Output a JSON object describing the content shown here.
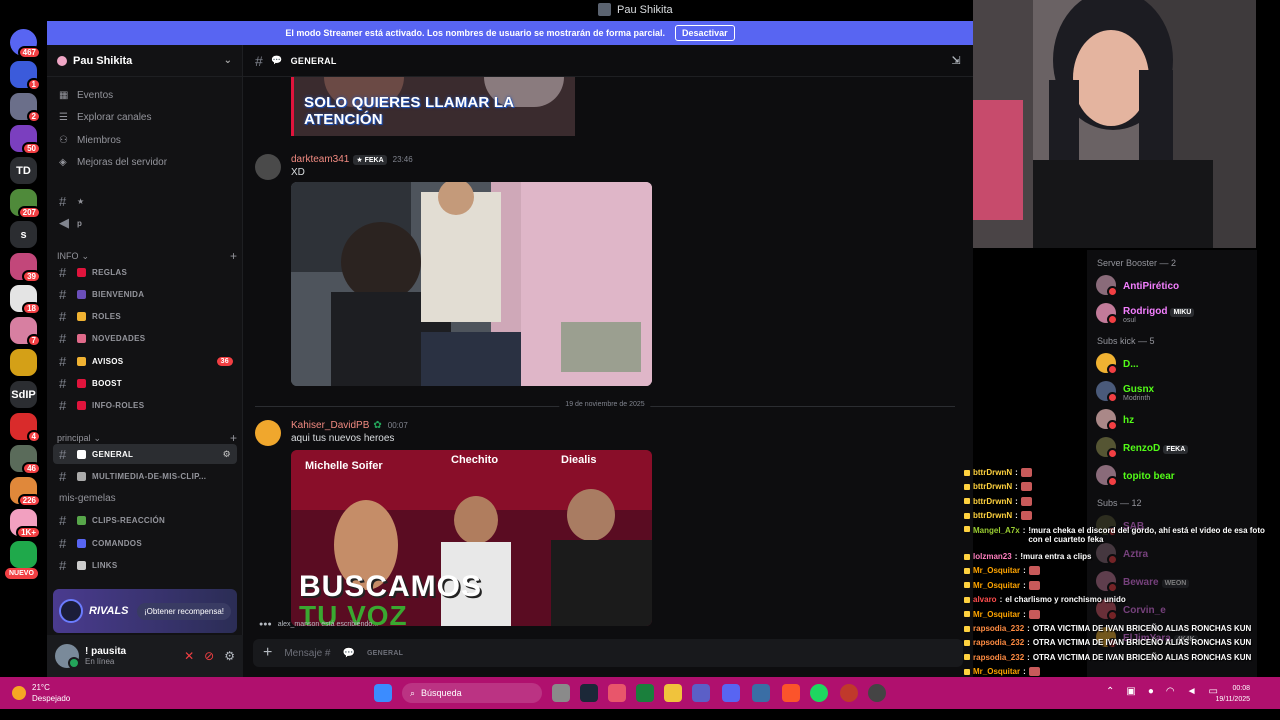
{
  "window": {
    "title": "Pau Shikita"
  },
  "server_rail": {
    "items": [
      {
        "name": "discord-home",
        "badge": "467",
        "color": "#5865f2",
        "label": ""
      },
      {
        "name": "server-1",
        "badge": "1",
        "color": "#3b5bdb",
        "label": ""
      },
      {
        "name": "server-2",
        "badge": "2",
        "color": "#6b6f8a",
        "label": ""
      },
      {
        "name": "server-3",
        "badge": "50",
        "color": "#7b3fbf",
        "label": ""
      },
      {
        "name": "server-td",
        "badge": "",
        "color": "#2b2d31",
        "label": "TD"
      },
      {
        "name": "server-5",
        "badge": "207",
        "color": "#4f8a3a",
        "label": ""
      },
      {
        "name": "server-s",
        "badge": "",
        "color": "#2b2d31",
        "label": "s"
      },
      {
        "name": "server-7",
        "badge": "39",
        "color": "#c2477a",
        "label": ""
      },
      {
        "name": "server-8",
        "badge": "18",
        "color": "#e4e4e4",
        "label": ""
      },
      {
        "name": "server-9",
        "badge": "7",
        "color": "#d77fa1",
        "label": ""
      },
      {
        "name": "server-10",
        "badge": "",
        "color": "#d4a017",
        "label": ""
      },
      {
        "name": "server-sdp",
        "badge": "",
        "color": "#2b2d31",
        "label": "SdIP"
      },
      {
        "name": "server-12",
        "badge": "4",
        "color": "#d92b2b",
        "label": ""
      },
      {
        "name": "server-13",
        "badge": "46",
        "color": "#5a6b5a",
        "label": ""
      },
      {
        "name": "server-14",
        "badge": "226",
        "color": "#e0883a",
        "label": ""
      },
      {
        "name": "server-15",
        "badge": "1K+",
        "color": "#f2a0c0",
        "label": ""
      },
      {
        "name": "server-16",
        "badge": "",
        "color": "#1fa94b",
        "label": ""
      }
    ],
    "new_label": "NUEVO"
  },
  "banner": {
    "text": "El modo Streamer está activado. Los nombres de usuario se mostrarán de forma parcial.",
    "button": "Desactivar"
  },
  "sidebar": {
    "guild_name": "Pau Shikita",
    "nav": [
      "Eventos",
      "Explorar canales",
      "Miembros",
      "Mejoras del servidor"
    ],
    "pinned": [
      "★",
      "p"
    ],
    "info_category": "INFO",
    "info_channels": [
      {
        "name": "REGLAS",
        "badge": "",
        "emoji_color": "#e0143c"
      },
      {
        "name": "BIENVENIDA",
        "badge": "",
        "emoji_color": "#6b4fbb"
      },
      {
        "name": "ROLES",
        "badge": "",
        "emoji_color": "#f0b232"
      },
      {
        "name": "NOVEDADES",
        "badge": "",
        "emoji_color": "#e06a8a"
      },
      {
        "name": "AVISOS",
        "badge": "36",
        "emoji_color": "#f0b232"
      },
      {
        "name": "BOOST",
        "badge": "",
        "emoji_color": "#e0143c"
      },
      {
        "name": "INFO-ROLES",
        "badge": "",
        "emoji_color": "#e0143c"
      }
    ],
    "principal_category": "principal",
    "principal_channels": [
      {
        "name": "GENERAL",
        "emoji_color": "#ffffff"
      },
      {
        "name": "MULTIMEDIA-DE-MIS-CLIP...",
        "emoji_color": "#aaaaaa"
      },
      {
        "name": "mis-gemelas",
        "emoji_color": ""
      },
      {
        "name": "CLIPS-REACCIÓN",
        "emoji_color": "#57a64a"
      },
      {
        "name": "COMANDOS",
        "emoji_color": "#5865f2"
      },
      {
        "name": "LINKS",
        "emoji_color": "#cccccc"
      }
    ],
    "promo": {
      "brand": "RIVALS",
      "button": "¡Obtener recompensa!"
    },
    "user": {
      "name": "! pausita",
      "status": "En línea"
    }
  },
  "chat": {
    "channel": "GENERAL",
    "top_image_caption": "SOLO QUIERES LLAMAR LA ATENCIÓN",
    "messages": [
      {
        "author": "darkteam341",
        "tag": "FEKA",
        "time": "23:46",
        "text": "XD",
        "color": "#f28b82"
      },
      {
        "author": "Kahiser_DavidPB",
        "tag": "",
        "time": "00:07",
        "text": "aqui tus nuevos heroes",
        "color": "#f28b82"
      }
    ],
    "date_divider": "19 de noviembre de 2025",
    "thumb": {
      "names": [
        "Michelle Soifer",
        "Chechito",
        "Diealis"
      ],
      "big": "BUSCAMOS",
      "big2": "TU VOZ"
    },
    "typing_user": "alex_manson",
    "typing_suffix": "está escribiendo...",
    "composer_placeholder": "Mensaje #",
    "composer_channel": "GENERAL"
  },
  "members": {
    "groups": [
      {
        "title": "Server Booster — 2",
        "members": [
          {
            "name": "AntiPirético",
            "sub": "",
            "tag": "",
            "color": "#f47fff"
          },
          {
            "name": "Rodrigod",
            "sub": "osul",
            "tag": "MIKU",
            "color": "#f47fff"
          }
        ]
      },
      {
        "title": "Subs kick — 5",
        "members": [
          {
            "name": "D...",
            "sub": "",
            "tag": "",
            "color": "#53fc18"
          },
          {
            "name": "Gusnx",
            "sub": "Modrinth",
            "tag": "",
            "color": "#53fc18"
          },
          {
            "name": "hz",
            "sub": "",
            "tag": "",
            "color": "#53fc18"
          },
          {
            "name": "RenzoD",
            "sub": "",
            "tag": "FEKA",
            "color": "#53fc18"
          },
          {
            "name": "topito bear",
            "sub": "",
            "tag": "",
            "color": "#53fc18"
          }
        ]
      },
      {
        "title": "Subs — 12",
        "members": [
          {
            "name": "SAB",
            "sub": "",
            "tag": "",
            "color": "#f47fff"
          },
          {
            "name": "Aztra",
            "sub": "",
            "tag": "",
            "color": "#f47fff"
          },
          {
            "name": "Beware",
            "sub": "",
            "tag": "WEON",
            "color": "#f47fff"
          },
          {
            "name": "Corvin_e",
            "sub": "",
            "tag": "",
            "color": "#f47fff"
          },
          {
            "name": "ElJimYara",
            "sub": "",
            "tag": "4K4K",
            "color": "#f47fff"
          }
        ]
      }
    ]
  },
  "twitch_chat": [
    {
      "user": "bttrDrwnN",
      "msg": "",
      "color": "#ffd23f"
    },
    {
      "user": "bttrDrwnN",
      "msg": "",
      "color": "#ffd23f"
    },
    {
      "user": "bttrDrwnN",
      "msg": "",
      "color": "#ffd23f"
    },
    {
      "user": "bttrDrwnN",
      "msg": "",
      "color": "#ffd23f"
    },
    {
      "user": "Mangel_A7x",
      "msg": "!mura cheka el discord del gordo, ahí está el video de esa foto con el cuarteto feka",
      "color": "#9acd32"
    },
    {
      "user": "lolzman23",
      "msg": "!mura entra a clips",
      "color": "#ff7fbf"
    },
    {
      "user": "Mr_Osquitar",
      "msg": "",
      "color": "#ffa500"
    },
    {
      "user": "Mr_Osquitar",
      "msg": "",
      "color": "#ffa500"
    },
    {
      "user": "alvaro",
      "msg": "el charlismo y ronchismo unido",
      "color": "#ff4d4d"
    },
    {
      "user": "Mr_Osquitar",
      "msg": "",
      "color": "#ffa500"
    },
    {
      "user": "rapsodia_232",
      "msg": "OTRA VICTIMA DE IVAN BRICEÑO ALIAS RONCHAS KUN",
      "color": "#ff8c42"
    },
    {
      "user": "rapsodia_232",
      "msg": "OTRA VICTIMA DE IVAN BRICEÑO ALIAS RONCHAS KUN",
      "color": "#ff8c42"
    },
    {
      "user": "rapsodia_232",
      "msg": "OTRA VICTIMA DE IVAN BRICEÑO ALIAS RONCHAS KUN",
      "color": "#ff8c42"
    },
    {
      "user": "Mr_Osquitar",
      "msg": "",
      "color": "#ffa500"
    },
    {
      "user": "Mr_Osquitar",
      "msg": "",
      "color": "#ffa500"
    }
  ],
  "taskbar": {
    "weather_temp": "21°C",
    "weather_desc": "Despejado",
    "search": "Búsqueda",
    "time": "00:08",
    "date": "19/11/2025"
  }
}
